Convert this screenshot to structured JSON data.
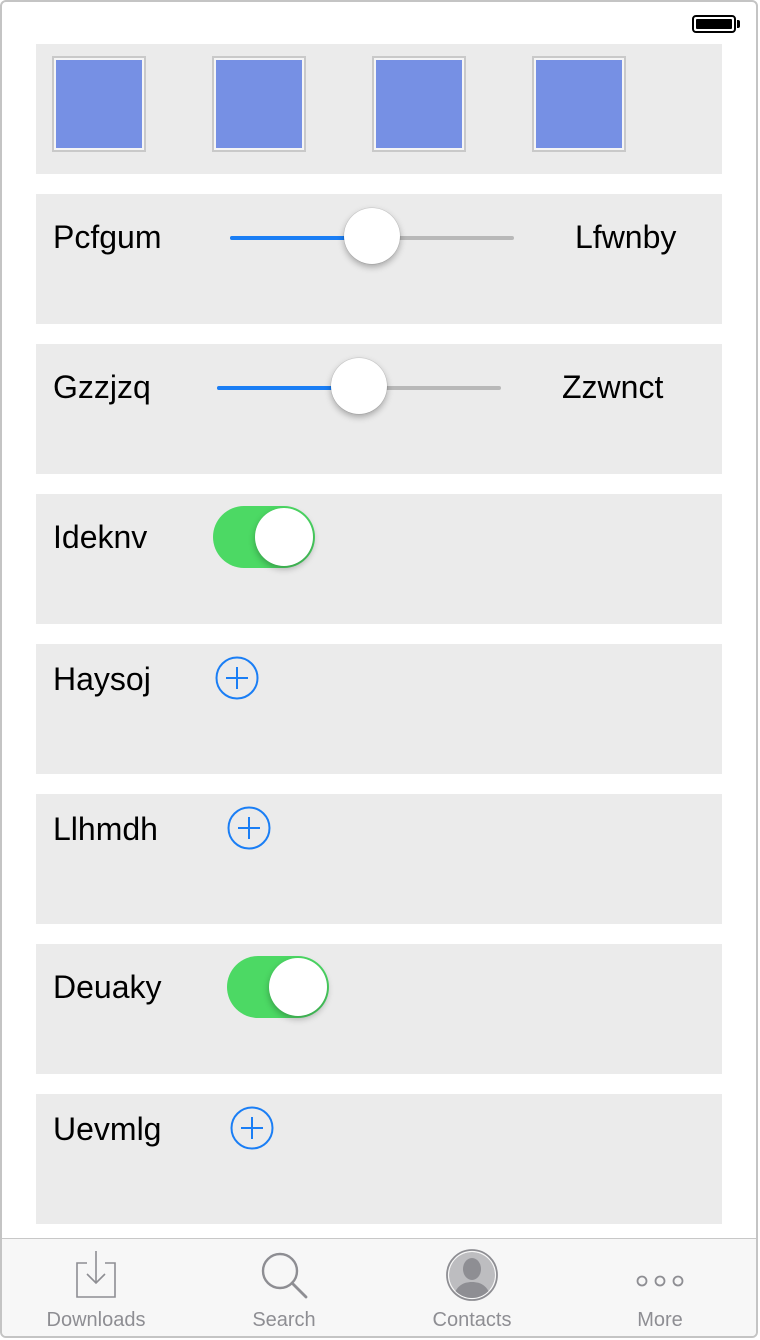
{
  "status_bar": {
    "battery_icon": "battery-full-icon"
  },
  "thumbnails": [
    {
      "color": "#7690e4"
    },
    {
      "color": "#7690e4"
    },
    {
      "color": "#7690e4"
    },
    {
      "color": "#7690e4"
    }
  ],
  "rows": {
    "slider1": {
      "label": "Pcfgum",
      "right_label": "Lfwnby",
      "value": 0.5
    },
    "slider2": {
      "label": "Gzzjzq",
      "right_label": "Zzwnct",
      "value": 0.5
    },
    "toggle1": {
      "label": "Ideknv",
      "on": true
    },
    "add1": {
      "label": "Haysoj",
      "icon": "add-circle-icon"
    },
    "add2": {
      "label": "Llhmdh",
      "icon": "add-circle-icon"
    },
    "toggle2": {
      "label": "Deuaky",
      "on": true
    },
    "add3": {
      "label": "Uevmlg",
      "icon": "add-circle-icon"
    }
  },
  "colors": {
    "accent": "#1a7ef5",
    "toggle_on": "#4cd964",
    "card_bg": "#ebebeb",
    "tab_label": "#8e8e93"
  },
  "tabbar": {
    "tabs": [
      {
        "label": "Downloads",
        "icon": "downloads-icon"
      },
      {
        "label": "Search",
        "icon": "search-icon"
      },
      {
        "label": "Contacts",
        "icon": "contacts-icon"
      },
      {
        "label": "More",
        "icon": "more-icon"
      }
    ]
  }
}
